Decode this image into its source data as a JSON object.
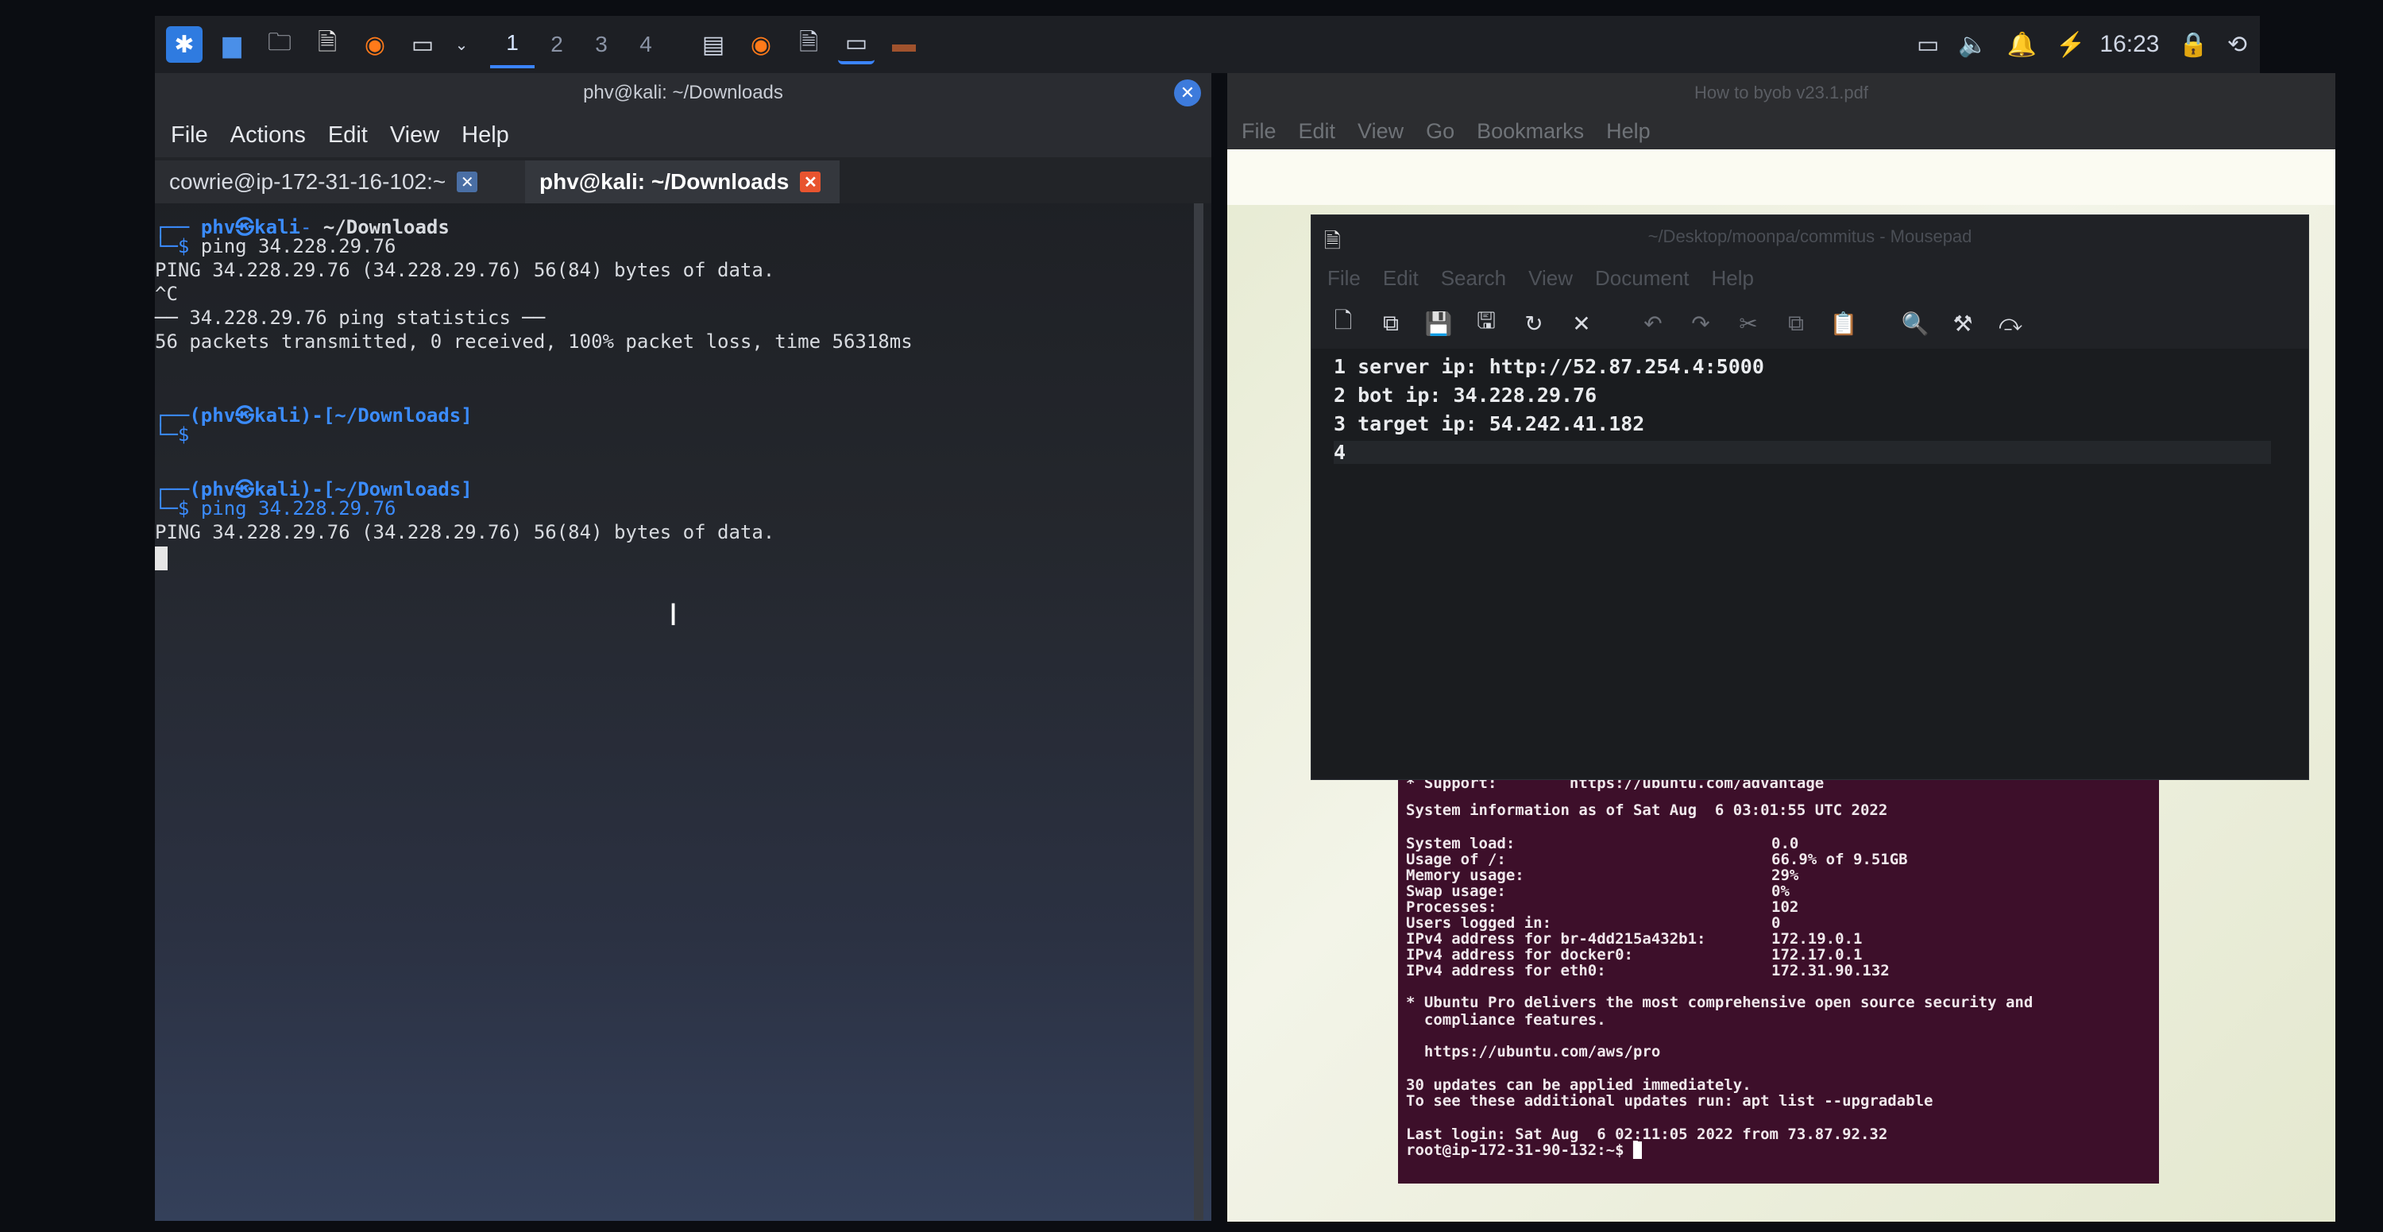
{
  "taskbar": {
    "workspaces": [
      "1",
      "2",
      "3",
      "4"
    ],
    "active_workspace": "1",
    "clock": "16:23",
    "icons": [
      "kali-menu-icon",
      "desktop-icon",
      "file-manager-icon",
      "text-editor-icon",
      "firefox-icon",
      "terminal-icon"
    ]
  },
  "terminal": {
    "window_title": "phv@kali: ~/Downloads",
    "menu": [
      "File",
      "Actions",
      "Edit",
      "View",
      "Help"
    ],
    "tabs": [
      {
        "label": "cowrie@ip-172-31-16-102:~"
      },
      {
        "label": "phv@kali: ~/Downloads"
      }
    ],
    "lines": [
      {
        "prompt_user": "phv㉿kali",
        "prompt_dir": "~/Downloads"
      },
      {
        "cmd": "ping 34.228.29.76"
      },
      {
        "text": "PING 34.228.29.76 (34.228.29.76) 56(84) bytes of data."
      },
      {
        "text": "^C"
      },
      {
        "text": "── 34.228.29.76 ping statistics ──"
      },
      {
        "text": "56 packets transmitted, 0 received, 100% packet loss, time 56318ms"
      }
    ],
    "prompt2": {
      "user": "(phv㉿kali)-[~/Downloads]",
      "symbol": "$"
    },
    "prompt3": {
      "user": "(phv㉿kali)-[~/Downloads]",
      "symbol": "$",
      "cmd": "ping 34.228.29.76"
    },
    "last_output": "PING 34.228.29.76 (34.228.29.76) 56(84) bytes of data."
  },
  "pdf_viewer": {
    "title": "How to byob v23.1.pdf",
    "menu": [
      "File",
      "Edit",
      "View",
      "Go",
      "Bookmarks",
      "Help"
    ]
  },
  "mousepad": {
    "title": "~/Desktop/moonpa/commitus - Mousepad",
    "menu": [
      "File",
      "Edit",
      "Search",
      "View",
      "Document",
      "Help"
    ],
    "lines": [
      {
        "num": "1",
        "text": "server ip: http://52.87.254.4:5000"
      },
      {
        "num": "2",
        "text": "bot ip: 34.228.29.76"
      },
      {
        "num": "3",
        "text": "target ip: 54.242.41.182"
      },
      {
        "num": "4",
        "text": ""
      }
    ]
  },
  "ubuntu_terminal": {
    "support_line": "* Support:        https://ubuntu.com/advantage",
    "sysinfo_header": "System information as of Sat Aug  6 03:01:55 UTC 2022",
    "stats": [
      {
        "k": "System load:",
        "v": "0.0"
      },
      {
        "k": "Usage of /:",
        "v": "66.9% of 9.51GB"
      },
      {
        "k": "Memory usage:",
        "v": "29%"
      },
      {
        "k": "Swap usage:",
        "v": "0%"
      },
      {
        "k": "Processes:",
        "v": "102"
      },
      {
        "k": "Users logged in:",
        "v": "0"
      },
      {
        "k": "IPv4 address for br-4dd215a432b1:",
        "v": "172.19.0.1"
      },
      {
        "k": "IPv4 address for docker0:",
        "v": "172.17.0.1"
      },
      {
        "k": "IPv4 address for eth0:",
        "v": "172.31.90.132"
      }
    ],
    "pro_line1": "* Ubuntu Pro delivers the most comprehensive open source security and",
    "pro_line2": "  compliance features.",
    "pro_url": "  https://ubuntu.com/aws/pro",
    "updates1": "30 updates can be applied immediately.",
    "updates2": "To see these additional updates run: apt list --upgradable",
    "last_login": "Last login: Sat Aug  6 02:11:05 2022 from 73.87.92.32",
    "prompt": "root@ip-172-31-90-132:~$"
  }
}
